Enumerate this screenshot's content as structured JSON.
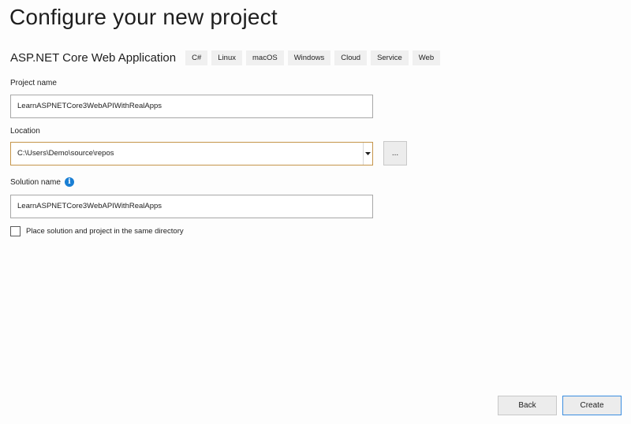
{
  "dialog": {
    "title": "Configure your new project"
  },
  "template": {
    "name": "ASP.NET Core Web Application",
    "tags": [
      "C#",
      "Linux",
      "macOS",
      "Windows",
      "Cloud",
      "Service",
      "Web"
    ]
  },
  "project_name": {
    "label": "Project name",
    "value": "LearnASPNETCore3WebAPIWithRealApps"
  },
  "location": {
    "label": "Location",
    "value": "C:\\Users\\Demo\\source\\repos",
    "browse_label": "..."
  },
  "solution_name": {
    "label": "Solution name",
    "value": "LearnASPNETCore3WebAPIWithRealApps",
    "info_icon": "info-icon"
  },
  "same_directory": {
    "label": "Place solution and project in the same directory",
    "checked": false
  },
  "buttons": {
    "back": "Back",
    "create": "Create"
  },
  "colors": {
    "accent": "#3c8ee0",
    "focus_border": "#c5954a",
    "info": "#1a7fd4"
  }
}
